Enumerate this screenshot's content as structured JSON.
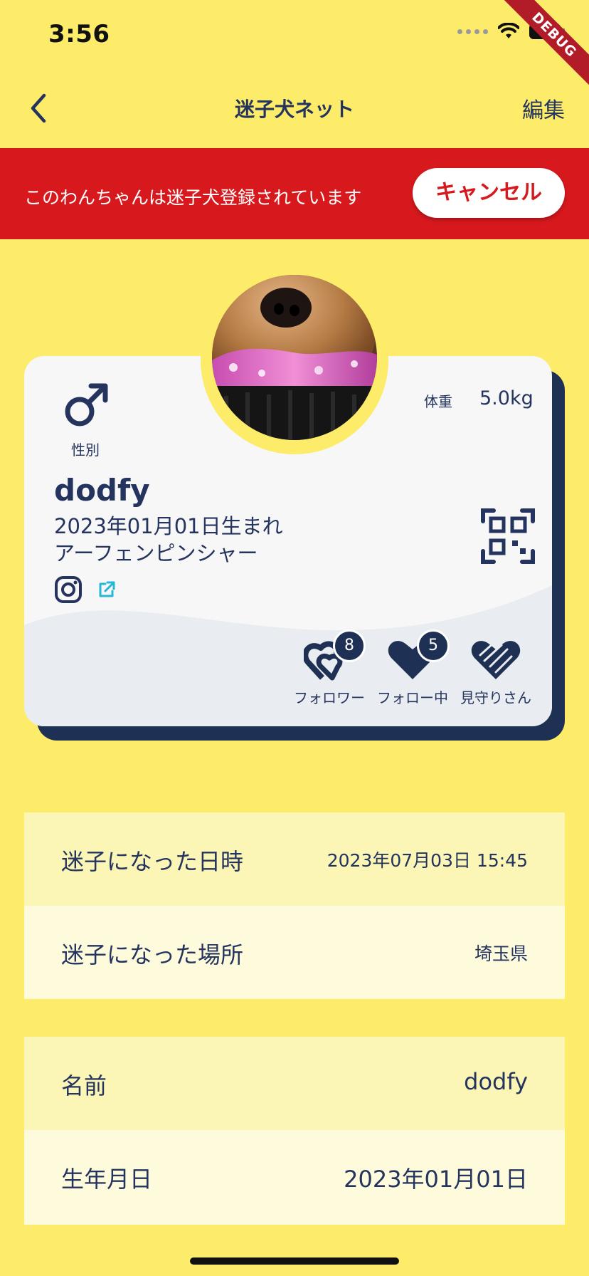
{
  "status_bar": {
    "time": "3:56",
    "debug_label": "DEBUG"
  },
  "nav": {
    "title": "迷子犬ネット",
    "edit_label": "編集"
  },
  "banner": {
    "message": "このわんちゃんは迷子犬登録されています",
    "cancel_label": "キャンセル",
    "color": "#D7191E"
  },
  "pet": {
    "gender_label": "性別",
    "weight_label": "体重",
    "weight_value": "5.0kg",
    "name": "dodfy",
    "birth": "2023年01月01日生まれ",
    "breed": "アーフェンピンシャー"
  },
  "stats": {
    "followers": {
      "label": "フォロワー",
      "count": "8"
    },
    "following": {
      "label": "フォロー中",
      "count": "5"
    },
    "watchers": {
      "label": "見守りさん"
    }
  },
  "lost_info": [
    {
      "label": "迷子になった日時",
      "value": "2023年07月03日 15:45"
    },
    {
      "label": "迷子になった場所",
      "value": "埼玉県"
    }
  ],
  "profile_info": [
    {
      "label": "名前",
      "value": "dodfy"
    },
    {
      "label": "生年月日",
      "value": "2023年01月01日"
    }
  ],
  "colors": {
    "background": "#FCEC6A",
    "navy": "#1F3055",
    "banner_red": "#D7191E",
    "accent_cyan": "#22B8D6"
  },
  "icons": [
    "back-chevron-icon",
    "male-symbol-icon",
    "instagram-icon",
    "external-link-icon",
    "qr-code-icon",
    "hearts-follower-icon",
    "heart-following-icon",
    "hands-heart-icon"
  ]
}
